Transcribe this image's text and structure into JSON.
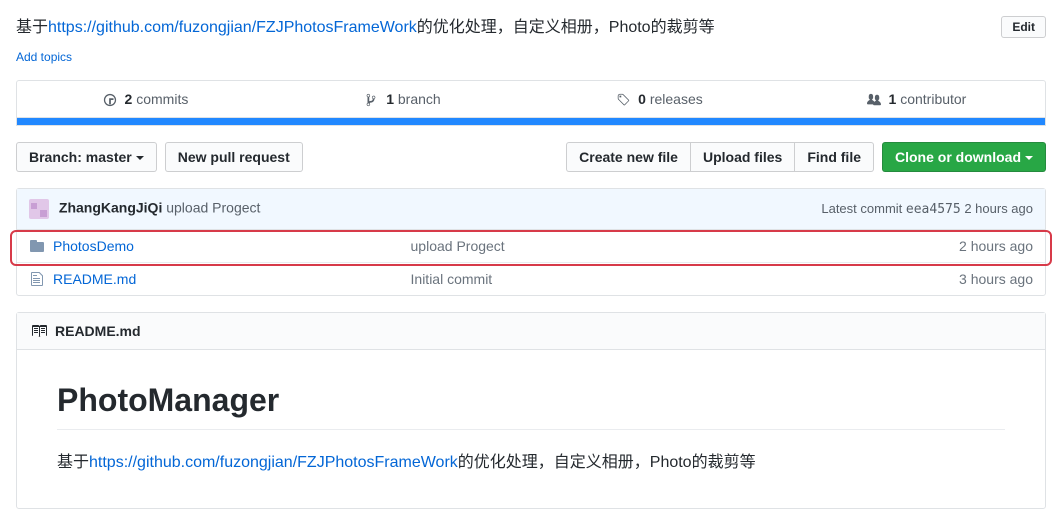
{
  "description": {
    "prefix": "基于",
    "link": "https://github.com/fuzongjian/FZJPhotosFrameWork",
    "suffix": "的优化处理，自定义相册，Photo的裁剪等"
  },
  "edit_button": "Edit",
  "add_topics": "Add topics",
  "stats": {
    "commits": {
      "count": "2",
      "label": "commits"
    },
    "branches": {
      "count": "1",
      "label": "branch"
    },
    "releases": {
      "count": "0",
      "label": "releases"
    },
    "contributors": {
      "count": "1",
      "label": "contributor"
    }
  },
  "branch_selector": {
    "label": "Branch:",
    "value": "master"
  },
  "new_pr": "New pull request",
  "create_file": "Create new file",
  "upload_files": "Upload files",
  "find_file": "Find file",
  "clone": "Clone or download",
  "latest_commit": {
    "author": "ZhangKangJiQi",
    "message": "upload Progect",
    "label": "Latest commit",
    "sha": "eea4575",
    "time": "2 hours ago"
  },
  "files": [
    {
      "type": "dir",
      "name": "PhotosDemo",
      "msg": "upload Progect",
      "time": "2 hours ago",
      "highlight": true
    },
    {
      "type": "file",
      "name": "README.md",
      "msg": "Initial commit",
      "time": "3 hours ago",
      "highlight": false
    }
  ],
  "readme": {
    "filename": "README.md",
    "title": "PhotoManager",
    "body_prefix": "基于",
    "body_link": "https://github.com/fuzongjian/FZJPhotosFrameWork",
    "body_suffix": "的优化处理，自定义相册，Photo的裁剪等"
  }
}
